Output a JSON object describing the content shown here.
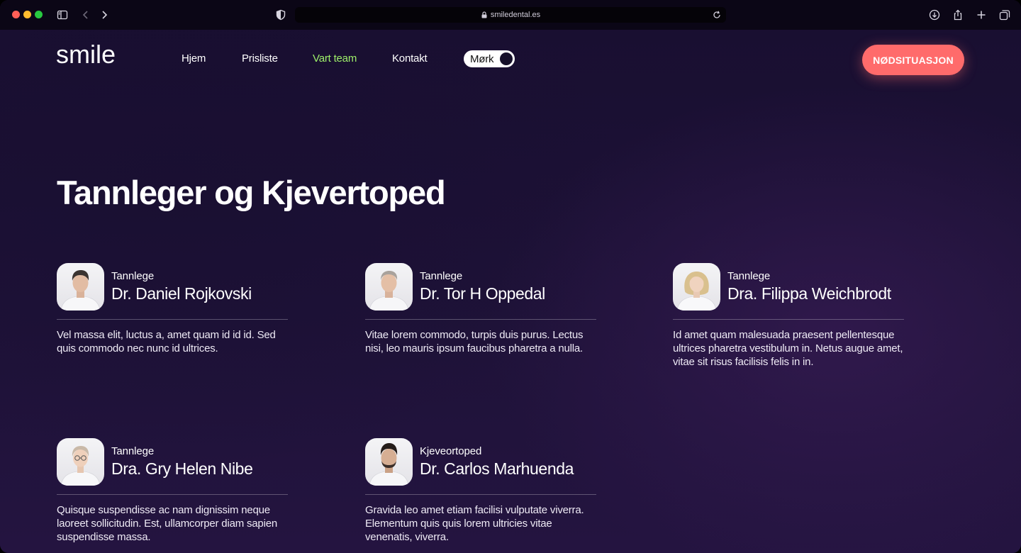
{
  "browser": {
    "url": "smiledental.es"
  },
  "header": {
    "logo": "smile",
    "nav": [
      {
        "label": "Hjem"
      },
      {
        "label": "Prisliste"
      },
      {
        "label": "Vart team"
      },
      {
        "label": "Kontakt"
      }
    ],
    "theme_toggle": {
      "label": "Mørk",
      "state": "dark"
    },
    "emergency_button": "NØDSITUASJON",
    "active_color": "#9ef06a",
    "accent_color": "#ff6b6b"
  },
  "main": {
    "title": "Tannleger og Kjevertoped",
    "team": [
      {
        "role": "Tannlege",
        "name": "Dr. Daniel Rojkovski",
        "bio": "Vel massa elit, luctus a, amet quam id id id. Sed quis commodo nec nunc id ultrices.",
        "photo": "portrait-man-dark-hair"
      },
      {
        "role": "Tannlege",
        "name": "Dr. Tor H Oppedal",
        "bio": "Vitae lorem commodo, turpis duis purus. Lectus nisi, leo mauris ipsum faucibus pharetra a nulla.",
        "photo": "portrait-man-grey-hair"
      },
      {
        "role": "Tannlege",
        "name": "Dra. Filippa Weichbrodt",
        "bio": "Id amet quam malesuada praesent pellentesque ultrices pharetra vestibulum in. Netus augue amet, vitae sit risus facilisis felis in in.",
        "photo": "portrait-woman-blonde"
      },
      {
        "role": "Tannlege",
        "name": "Dra. Gry Helen Nibe",
        "bio": "Quisque suspendisse ac nam dignissim neque laoreet sollicitudin. Est, ullamcorper diam sapien suspendisse massa.",
        "photo": "portrait-woman-glasses"
      },
      {
        "role": "Kjeveortoped",
        "name": "Dr. Carlos Marhuenda",
        "bio": "Gravida leo amet etiam facilisi vulputate viverra. Elementum quis quis lorem ultricies vitae venenatis, viverra.",
        "photo": "portrait-man-beard"
      }
    ]
  }
}
